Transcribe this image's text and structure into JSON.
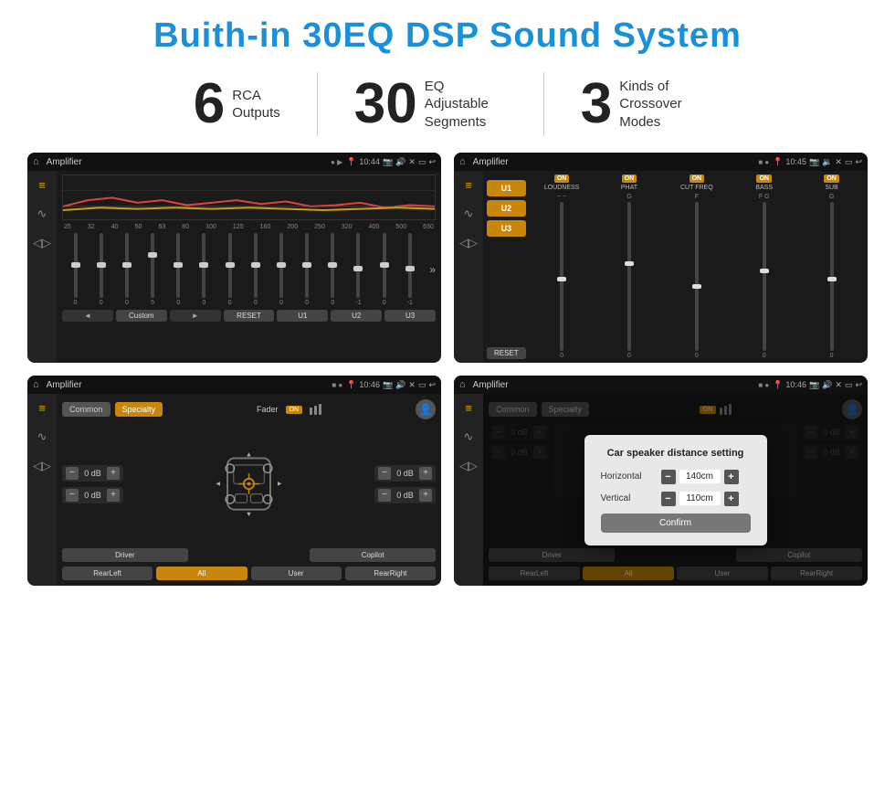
{
  "page": {
    "background": "#ffffff"
  },
  "header": {
    "title": "Buith-in 30EQ DSP Sound System"
  },
  "stats": [
    {
      "number": "6",
      "desc_line1": "RCA",
      "desc_line2": "Outputs"
    },
    {
      "number": "30",
      "desc_line1": "EQ Adjustable",
      "desc_line2": "Segments"
    },
    {
      "number": "3",
      "desc_line1": "Kinds of",
      "desc_line2": "Crossover Modes"
    }
  ],
  "screens": [
    {
      "id": "screen1",
      "statusbar": {
        "app": "Amplifier",
        "time": "10:44"
      },
      "eq_labels": [
        "25",
        "32",
        "40",
        "50",
        "63",
        "80",
        "100",
        "125",
        "160",
        "200",
        "250",
        "320",
        "400",
        "500",
        "630"
      ],
      "eq_values": [
        "0",
        "0",
        "0",
        "5",
        "0",
        "0",
        "0",
        "0",
        "0",
        "0",
        "0",
        "-1",
        "0",
        "-1"
      ],
      "preset_label": "Custom",
      "buttons": [
        "RESET",
        "U1",
        "U2",
        "U3"
      ]
    },
    {
      "id": "screen2",
      "statusbar": {
        "app": "Amplifier",
        "time": "10:45"
      },
      "presets": [
        "U1",
        "U2",
        "U3"
      ],
      "modules": [
        "LOUDNESS",
        "PHAT",
        "CUT FREQ",
        "BASS",
        "SUB"
      ],
      "reset_label": "RESET"
    },
    {
      "id": "screen3",
      "statusbar": {
        "app": "Amplifier",
        "time": "10:46"
      },
      "tabs": [
        "Common",
        "Specialty"
      ],
      "active_tab": "Specialty",
      "fader_label": "Fader",
      "db_values": [
        "0 dB",
        "0 dB",
        "0 dB",
        "0 dB"
      ],
      "bottom_buttons": [
        "Driver",
        "",
        "Copilot",
        "RearLeft",
        "All",
        "User",
        "RearRight"
      ]
    },
    {
      "id": "screen4",
      "statusbar": {
        "app": "Amplifier",
        "time": "10:46"
      },
      "tabs": [
        "Common",
        "Specialty"
      ],
      "dialog": {
        "title": "Car speaker distance setting",
        "horizontal_label": "Horizontal",
        "horizontal_value": "140cm",
        "vertical_label": "Vertical",
        "vertical_value": "110cm",
        "confirm_label": "Confirm"
      },
      "db_values": [
        "0 dB",
        "0 dB"
      ],
      "bottom_buttons": [
        "Driver",
        "Copilot",
        "RearLeft",
        "All",
        "User",
        "RearRight"
      ]
    }
  ]
}
